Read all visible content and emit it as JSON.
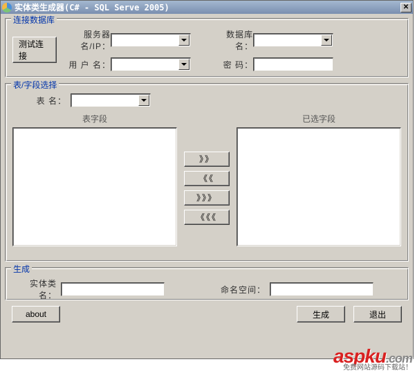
{
  "window": {
    "title": "实体类生成器(C# - SQL Serve 2005)"
  },
  "group_db": {
    "legend": "连接数据库",
    "server_label": "服务器名/IP：",
    "user_label": "用 户 名：",
    "dbname_label": "数据库名：",
    "password_label": "密  码：",
    "server_value": "",
    "user_value": "",
    "dbname_value": "",
    "password_value": "",
    "test_btn": "测试连接"
  },
  "group_field": {
    "legend": "表/字段选择",
    "table_label": "表    名：",
    "table_value": "",
    "left_title": "表字段",
    "right_title": "已选字段",
    "btn_add": "》》",
    "btn_remove": "《《",
    "btn_add_all": "》》》",
    "btn_remove_all": "《《《"
  },
  "group_gen": {
    "legend": "生成",
    "entity_label": "实体类名：",
    "entity_value": "",
    "ns_label": "命名空间：",
    "ns_value": ""
  },
  "footer": {
    "about": "about",
    "generate": "生成",
    "exit": "退出"
  },
  "watermark": {
    "text": "aspku",
    "suffix": ".com",
    "sub": "免费网站源码下载站！"
  }
}
